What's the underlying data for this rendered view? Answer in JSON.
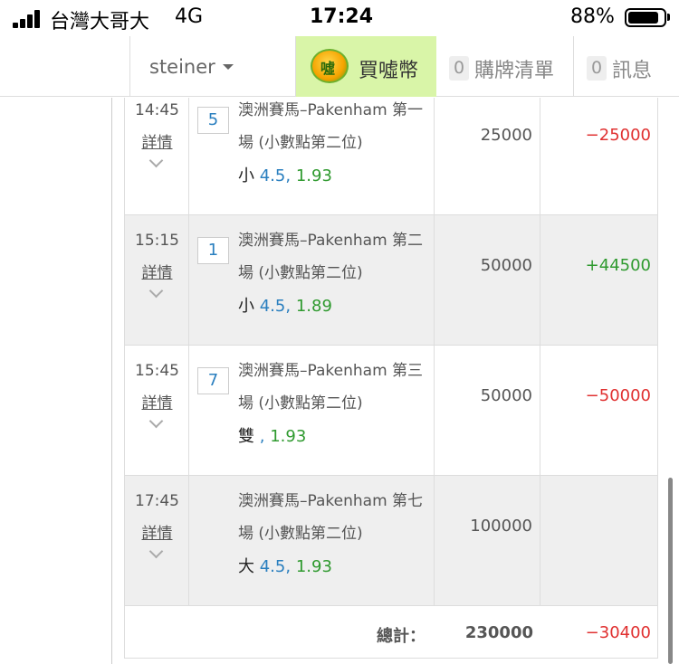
{
  "status_bar": {
    "carrier": "台灣大哥大",
    "network": "4G",
    "time": "17:24",
    "battery_percent": "88%",
    "battery_level": 0.88
  },
  "nav": {
    "username": "steiner",
    "buy_coin_label": "買噓幣",
    "coin_icon": "coin-icon",
    "cart_count": "0",
    "cart_label": "購牌清單",
    "messages_count": "0",
    "messages_label": "訊息"
  },
  "rows": [
    {
      "time": "14:45",
      "detail": "詳情",
      "number": "5",
      "desc": "澳洲賽馬–Pakenham 第一場 (小數點第二位)",
      "pick": "小",
      "line": "4.5,",
      "odds": "1.93",
      "amount": "25000",
      "result": "−25000",
      "result_type": "neg"
    },
    {
      "time": "15:15",
      "detail": "詳情",
      "number": "1",
      "desc": "澳洲賽馬–Pakenham 第二場 (小數點第二位)",
      "pick": "小",
      "line": "4.5,",
      "odds": "1.89",
      "amount": "50000",
      "result": "+44500",
      "result_type": "pos"
    },
    {
      "time": "15:45",
      "detail": "詳情",
      "number": "7",
      "desc": "澳洲賽馬–Pakenham 第三場 (小數點第二位)",
      "pick": "雙",
      "line": ",",
      "odds": "1.93",
      "amount": "50000",
      "result": "−50000",
      "result_type": "neg"
    },
    {
      "time": "17:45",
      "detail": "詳情",
      "number": "",
      "desc": "澳洲賽馬–Pakenham 第七場 (小數點第二位)",
      "pick": "大",
      "line": "4.5,",
      "odds": "1.93",
      "amount": "100000",
      "result": "",
      "result_type": ""
    }
  ],
  "total": {
    "label": "總計：",
    "amount": "230000",
    "result": "−30400"
  }
}
